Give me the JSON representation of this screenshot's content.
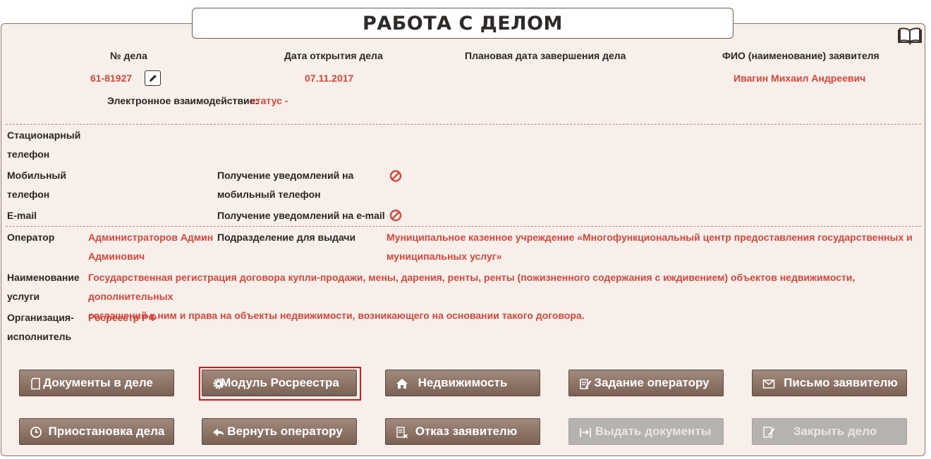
{
  "title": "РАБОТА С ДЕЛОМ",
  "header": {
    "case_no_label": "№ дела",
    "case_no": "61-81927",
    "open_date_label": "Дата открытия дела",
    "open_date": "07.11.2017",
    "planned_date_label": "Плановая дата завершения дела",
    "applicant_label": "ФИО (наименование) заявителя",
    "applicant": "Ивагин Михаил Андреевич",
    "interaction_label": "Электронное взаимодействие:",
    "interaction_status": "статус -"
  },
  "contacts": {
    "landline_label_1": "Стационарный",
    "landline_label_2": "телефон",
    "mobile_label_1": "Мобильный",
    "mobile_label_2": "телефон",
    "email_label": "E-mail",
    "notify_mobile_label_1": "Получение уведомлений на",
    "notify_mobile_label_2": "мобильный телефон",
    "notify_email_label": "Получение уведомлений на e-mail"
  },
  "details": {
    "operator_label": "Оператор",
    "operator_1": "Администраторов Админ",
    "operator_2": "Админович",
    "division_label": "Подразделение для выдачи",
    "division_1": "Муниципальное казенное учреждение «Многофункциональный центр предоставления государственных и",
    "division_2": "муниципальных услуг»",
    "service_label_1": "Наименование",
    "service_label_2": "услуги",
    "service_1": "Государственная регистрация договора купли-продажи, мены, дарения, ренты, ренты (пожизненного содержания с иждивением) объектов недвижимости, дополнительных",
    "service_2": "соглашений к ним и права на объекты недвижимости, возникающего на основании такого договора.",
    "executor_label_1": "Организация-",
    "executor_label_2": "исполнитель",
    "executor": "Росреестр РФ"
  },
  "buttons": {
    "documents": "Документы в деле",
    "rosreestr": "Модуль Росреестра",
    "property": "Недвижимость",
    "task": "Задание оператору",
    "letter": "Письмо заявителю",
    "suspend": "Приостановка дела",
    "return": "Вернуть оператору",
    "refuse": "Отказ заявителю",
    "issue": "Выдать документы",
    "close": "Закрыть дело"
  },
  "icons": {
    "book": "book-icon",
    "edit": "pencil-icon",
    "notify_off": "prohibited-icon"
  },
  "colors": {
    "accent_text": "#d2463a",
    "button": "#8b7367",
    "button_disabled": "#b6b2b0",
    "highlight": "#d6161a",
    "panel_bg": "#f8efea"
  }
}
